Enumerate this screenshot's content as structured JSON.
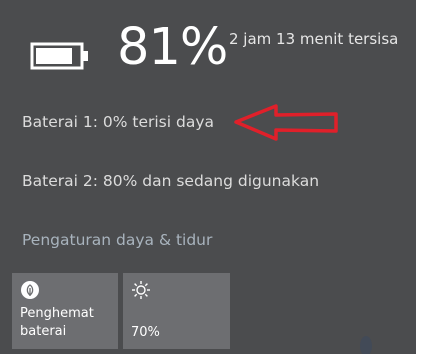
{
  "summary": {
    "percent": "81%",
    "remaining": "2 jam 13 menit tersisa"
  },
  "battery1": {
    "text": "Baterai 1: 0% terisi daya"
  },
  "battery2": {
    "text": "Baterai 2: 80% dan sedang digunakan"
  },
  "settings_link": "Pengaturan daya & tidur",
  "tiles": [
    {
      "label": "Penghemat baterai",
      "icon": "leaf-icon"
    },
    {
      "label": "70%",
      "icon": "brightness-sun-icon"
    }
  ],
  "colors": {
    "flyout_bg": "#4b4c4e",
    "tile_bg": "#6d6e71",
    "annotation_arrow": "#e0202a",
    "link": "#a8b3bd"
  }
}
